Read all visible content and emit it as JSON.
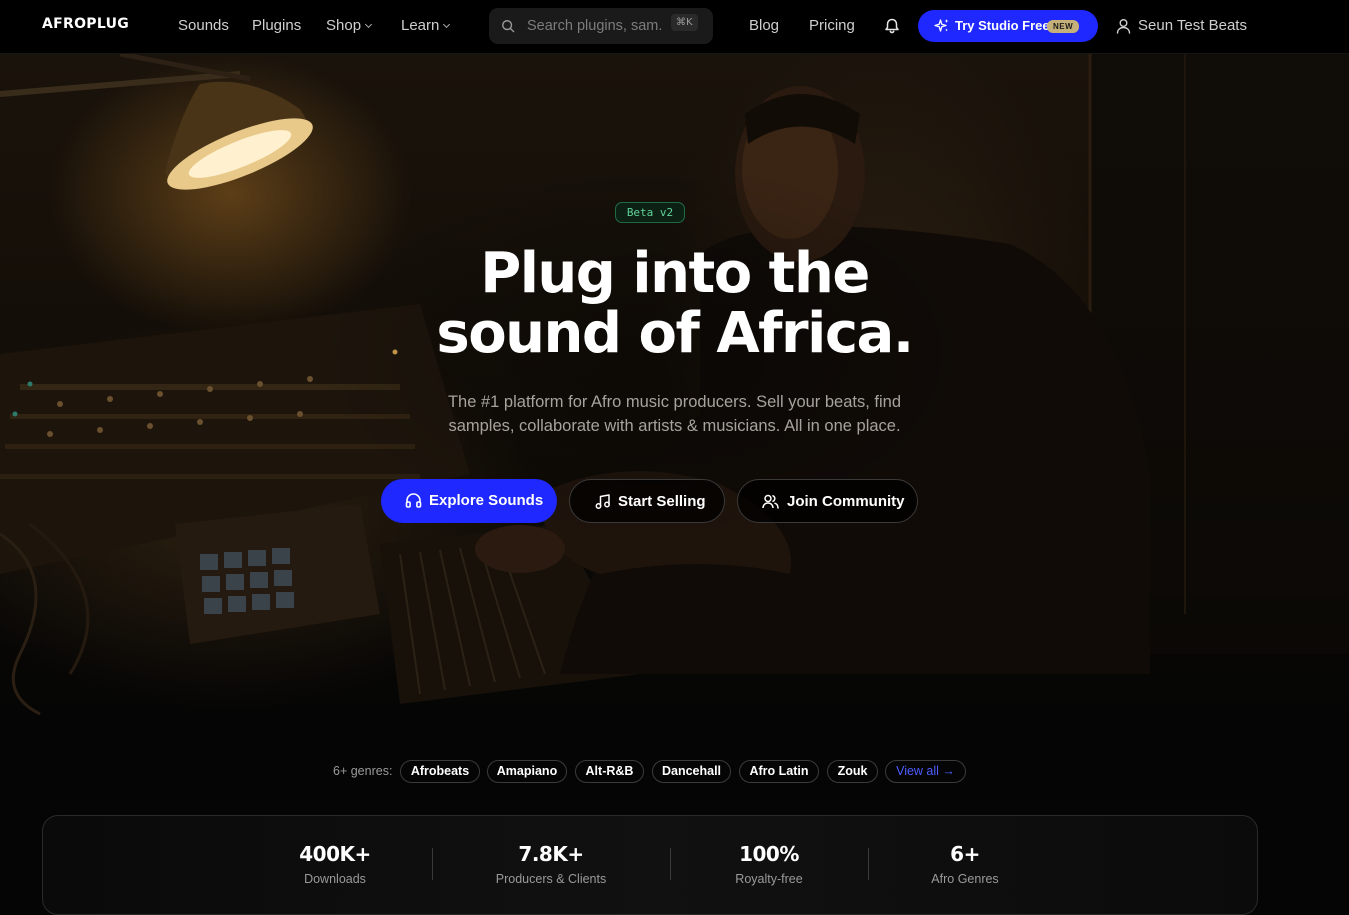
{
  "nav": {
    "logo": "AFROPLUG",
    "links": [
      {
        "label": "Sounds",
        "has_menu": false
      },
      {
        "label": "Plugins",
        "has_menu": false
      },
      {
        "label": "Shop",
        "has_menu": true
      },
      {
        "label": "Learn",
        "has_menu": true
      }
    ],
    "search": {
      "placeholder": "Search plugins, sam...",
      "shortcut": "⌘K",
      "icon": "search-icon"
    },
    "blog": "Blog",
    "pricing": "Pricing",
    "bell_icon": "bell-icon",
    "studio_button": {
      "label": "Try Studio Free",
      "badge": "NEW",
      "icon": "sparkles-icon",
      "color": "#1e28ff"
    },
    "user": {
      "name": "Seun Test Beats",
      "icon": "user-icon"
    }
  },
  "hero": {
    "badge": "Beta v2",
    "headline_line1": "Plug into the",
    "headline_line2": "sound of Africa.",
    "subtitle_line1": "The #1 platform for Afro music producers. Sell your beats, find",
    "subtitle_line2": "samples, collaborate with artists & musicians. All in one place.",
    "buttons": [
      {
        "label": "Explore Sounds",
        "icon": "headphones-icon",
        "style": "primary"
      },
      {
        "label": "Start Selling",
        "icon": "music-note-icon",
        "style": "outline"
      },
      {
        "label": "Join Community",
        "icon": "users-icon",
        "style": "outline"
      }
    ]
  },
  "genres": {
    "label": "6+ genres:",
    "items": [
      "Afrobeats",
      "Amapiano",
      "Alt-R&B",
      "Dancehall",
      "Afro Latin",
      "Zouk"
    ],
    "view_all": "View all →"
  },
  "stats": [
    {
      "value": "400K+",
      "label": "Downloads"
    },
    {
      "value": "7.8K+",
      "label": "Producers & Clients"
    },
    {
      "value": "100%",
      "label": "Royalty-free"
    },
    {
      "value": "6+",
      "label": "Afro Genres"
    }
  ],
  "colors": {
    "accent": "#1e28ff",
    "badge_green": "#5fd39a",
    "background": "#050505"
  }
}
